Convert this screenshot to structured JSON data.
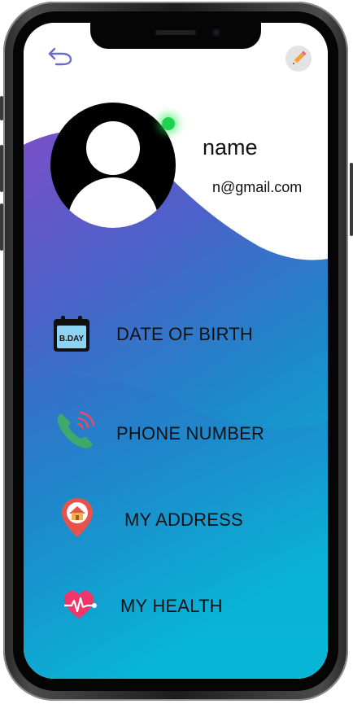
{
  "profile": {
    "name": "name",
    "email": "n@gmail.com"
  },
  "header": {
    "back_icon": "undo-arrow-icon",
    "edit_icon": "pencil-icon"
  },
  "menu": [
    {
      "label": "DATE OF BIRTH",
      "icon": "birthday-calendar-icon",
      "icon_text": "B.DAY"
    },
    {
      "label": "PHONE NUMBER",
      "icon": "phone-ringing-icon"
    },
    {
      "label": "MY ADDRESS",
      "icon": "home-location-pin-icon"
    },
    {
      "label": "MY HEALTH",
      "icon": "heart-pulse-icon"
    }
  ],
  "colors": {
    "gradient_top": "#7a4fc8",
    "gradient_mid": "#1f86c9",
    "gradient_bottom": "#07b6d6",
    "status_online": "#1fd34e",
    "heart": "#f0366b",
    "pin": "#e8524a",
    "phone": "#3fa86b"
  }
}
